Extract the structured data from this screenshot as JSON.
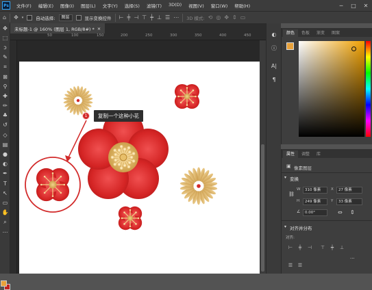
{
  "menubar": {
    "logo": "Ps",
    "items": [
      "文件(F)",
      "编辑(E)",
      "图像(I)",
      "图层(L)",
      "文字(Y)",
      "选择(S)",
      "滤镜(T)",
      "3D(D)",
      "视图(V)",
      "窗口(W)",
      "帮助(H)"
    ],
    "window_buttons": [
      "─",
      "□",
      "✕"
    ]
  },
  "options_bar": {
    "auto_select_label": "自动选择:",
    "auto_select_value": "图层",
    "show_transform_label": "显示变换控件",
    "mode_3d_label": "3D 模式:"
  },
  "document": {
    "tab_label": "未标题-1 @ 160% (图层 1, RGB/8#) *",
    "close": "×",
    "ruler_labels": [
      "50",
      "100",
      "150",
      "200",
      "250",
      "300",
      "350",
      "400",
      "450"
    ]
  },
  "annotation": {
    "number": "1",
    "text": "复制一个这种小花",
    "color": "#d22a2a"
  },
  "color_panel": {
    "tabs": [
      "颜色",
      "色板",
      "渐变",
      "图案"
    ],
    "fg_color": "#e8a13a",
    "bg_color": "#c0201f",
    "hue_color": "#f0a000"
  },
  "properties_panel": {
    "tabs": [
      "属性",
      "调整",
      "库"
    ],
    "layer_type": "像素图层",
    "transform_title": "变换",
    "w_label": "W",
    "w_value": "310 像素",
    "h_label": "H",
    "h_value": "249 像素",
    "x_label": "X",
    "x_value": "27 像素",
    "y_label": "Y",
    "y_value": "33 像素",
    "angle_value": "0.00°",
    "align_title": "对齐并分布",
    "align_label": "对齐:",
    "more": "..."
  },
  "tools": [
    "move-icon",
    "marquee-icon",
    "lasso-icon",
    "quick-select-icon",
    "crop-icon",
    "frame-icon",
    "eyedropper-icon",
    "healing-icon",
    "brush-icon",
    "stamp-icon",
    "history-brush-icon",
    "eraser-icon",
    "gradient-icon",
    "blur-icon",
    "dodge-icon",
    "pen-icon",
    "type-icon",
    "path-select-icon",
    "shape-icon",
    "hand-icon",
    "zoom-icon",
    "more-tools-icon"
  ],
  "tool_glyphs": [
    "✥",
    "⬚",
    "ↄ",
    "✎",
    "⌗",
    "⊠",
    "⚲",
    "✚",
    "✏",
    "♣",
    "↺",
    "◇",
    "▤",
    "●",
    "◐",
    "✒",
    "T",
    "↖",
    "▭",
    "✋",
    "⌕",
    "⋯"
  ],
  "side_icons": [
    "◐",
    "ⓘ",
    "A|",
    "¶"
  ]
}
